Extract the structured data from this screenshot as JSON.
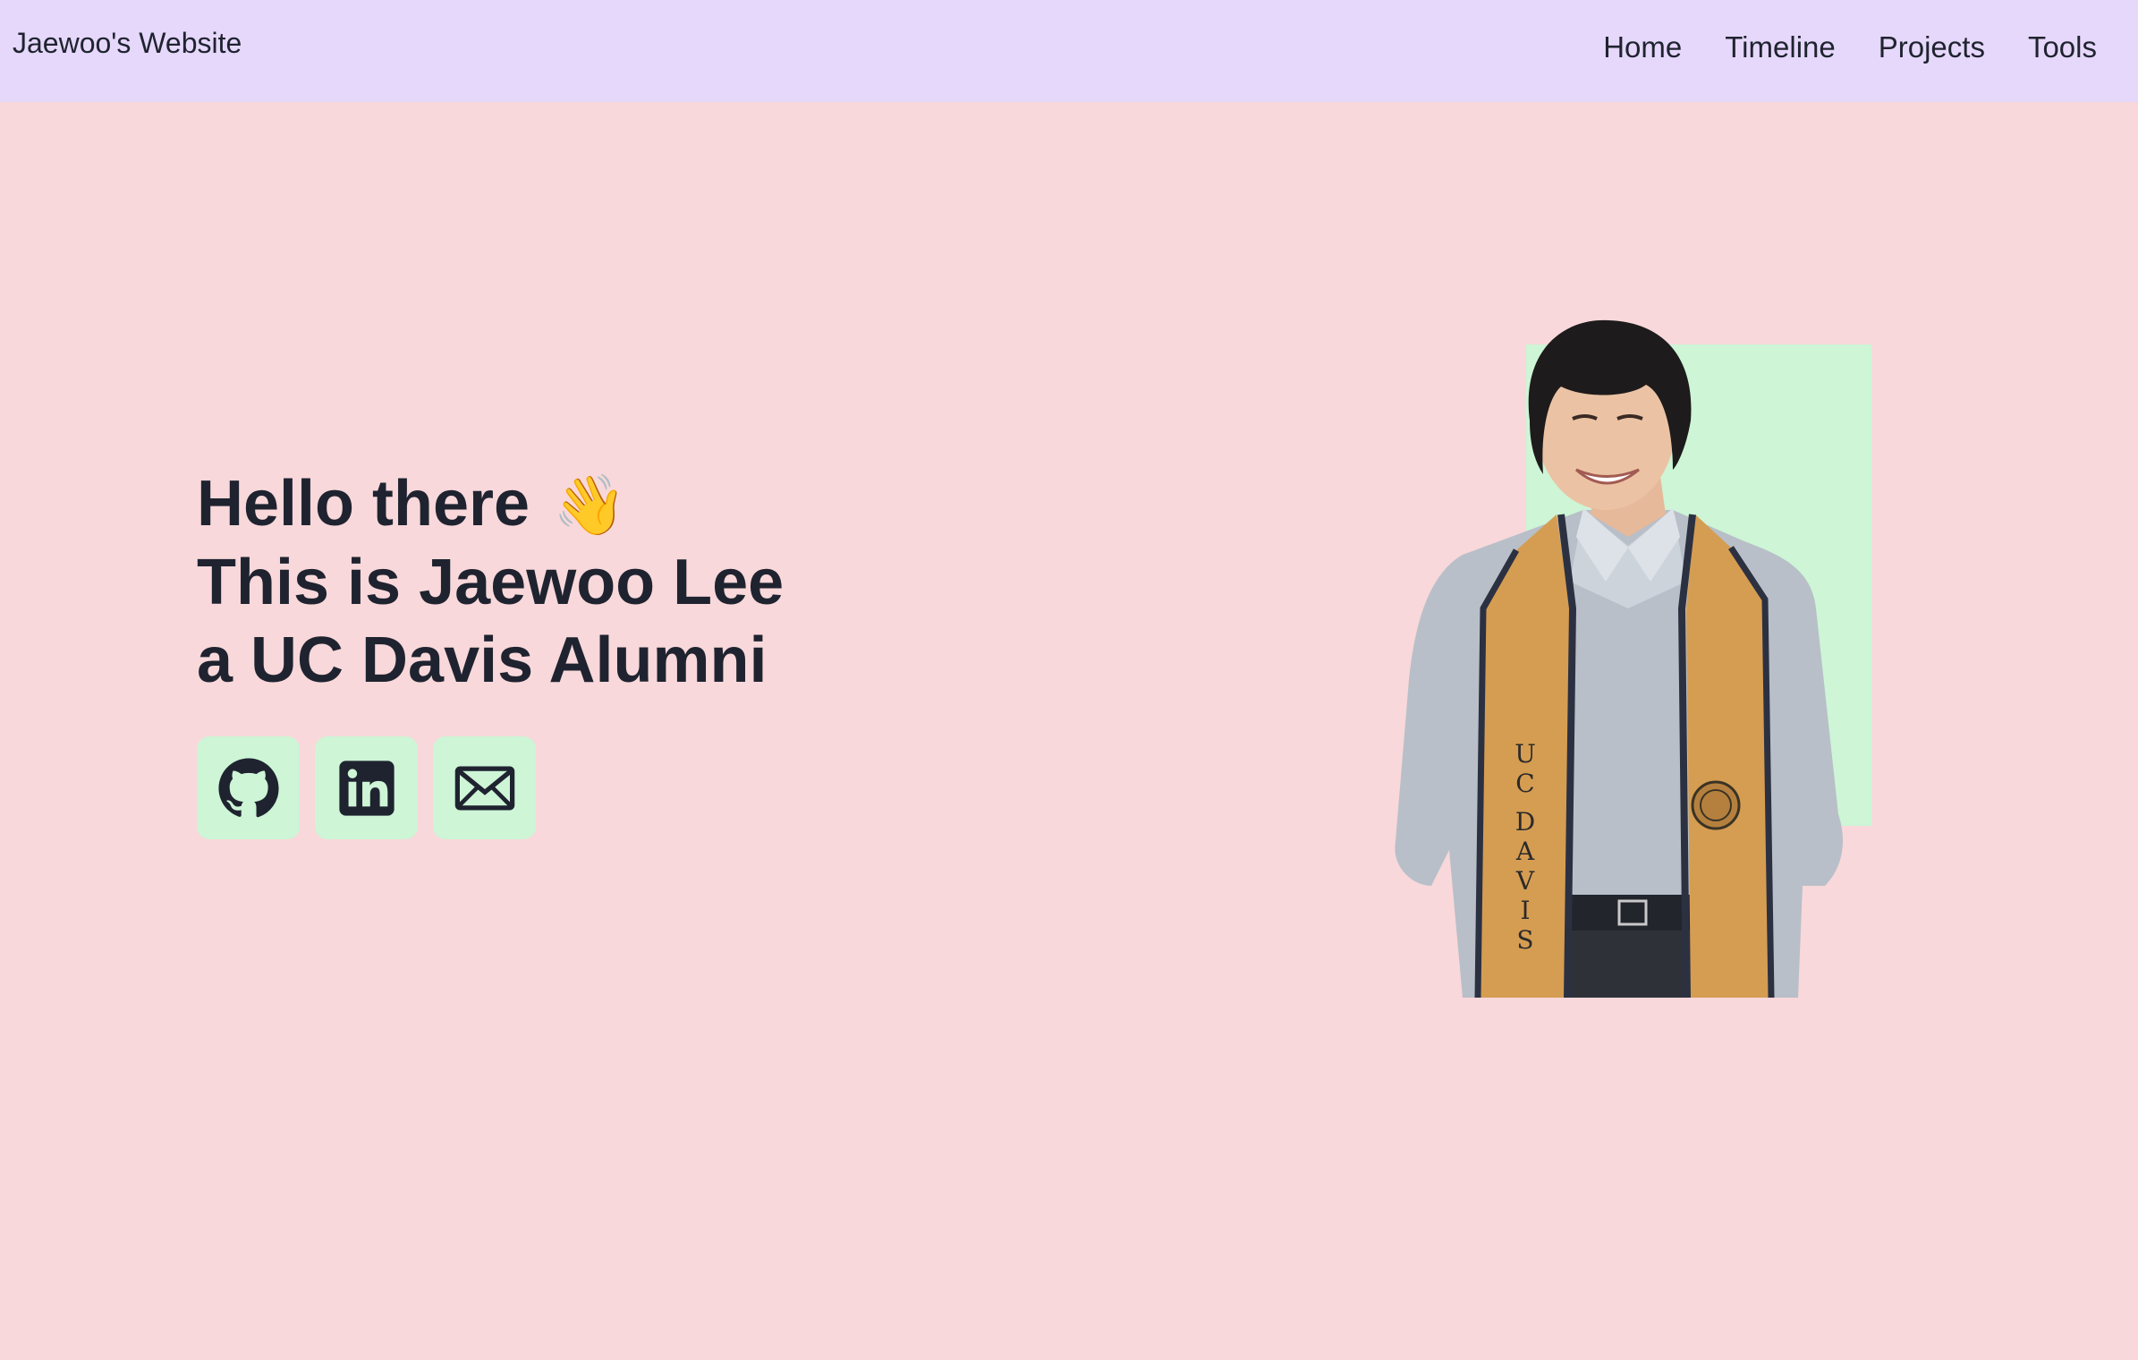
{
  "header": {
    "brand": "Jaewoo's Website",
    "nav": [
      "Home",
      "Timeline",
      "Projects",
      "Tools"
    ]
  },
  "hero": {
    "line1": "Hello there",
    "wave_emoji": "👋",
    "line2": "This is Jaewoo Lee",
    "line3": "a UC Davis Alumni"
  },
  "socials": [
    {
      "icon": "github-icon"
    },
    {
      "icon": "linkedin-icon"
    },
    {
      "icon": "mail-icon"
    }
  ],
  "photo": {
    "stole_letters": [
      "U",
      "C",
      "D",
      "A",
      "V",
      "I",
      "S"
    ]
  },
  "colors": {
    "page_bg": "#f8d8da",
    "nav_bg": "#e6d8fa",
    "accent_green": "#cdf5d6",
    "text": "#1f2330"
  }
}
